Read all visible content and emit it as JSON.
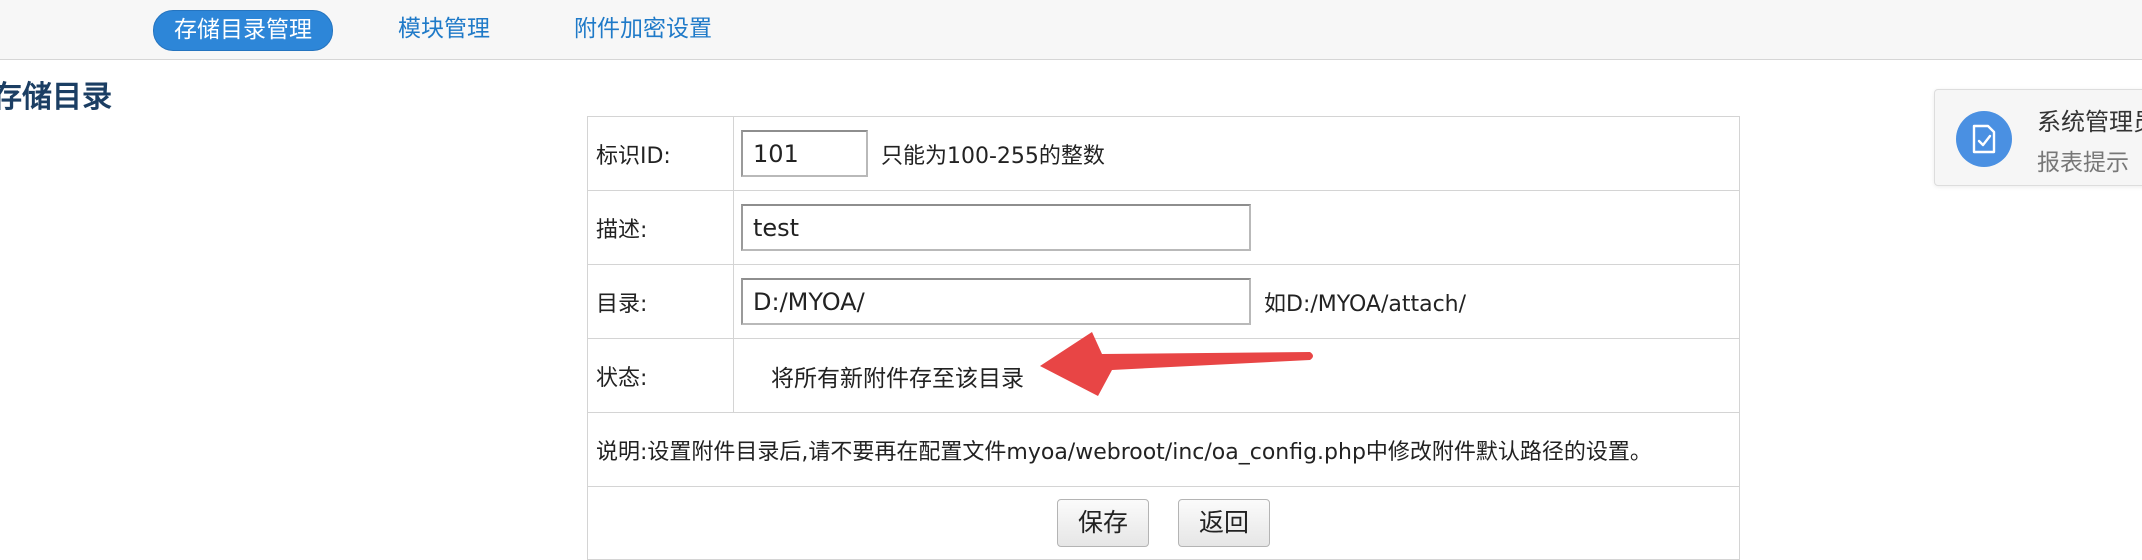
{
  "tabs": [
    {
      "label": "存储目录管理",
      "active": true
    },
    {
      "label": "模块管理",
      "active": false
    },
    {
      "label": "附件加密设置",
      "active": false
    }
  ],
  "page_title": "存储目录",
  "form": {
    "id_label": "标识ID:",
    "id_value": "101",
    "id_hint": "只能为100-255的整数",
    "desc_label": "描述:",
    "desc_value": "test",
    "dir_label": "目录:",
    "dir_value": "D:/MYOA/",
    "dir_hint": "如D:/MYOA/attach/",
    "status_label": "状态:",
    "status_text": "将所有新附件存至该目录",
    "note": "说明:设置附件目录后,请不要再在配置文件myoa/webroot/inc/oa_config.php中修改附件默认路径的设置。",
    "save_label": "保存",
    "back_label": "返回"
  },
  "notification": {
    "title": "系统管理员",
    "subtitle": "报表提示",
    "icon": "document-check-icon"
  },
  "annotation": {
    "icon": "red-arrow-icon",
    "color": "#e84545"
  },
  "colors": {
    "accent": "#2d86d8",
    "link": "#1f7ac8",
    "heading": "#1b3e63"
  }
}
